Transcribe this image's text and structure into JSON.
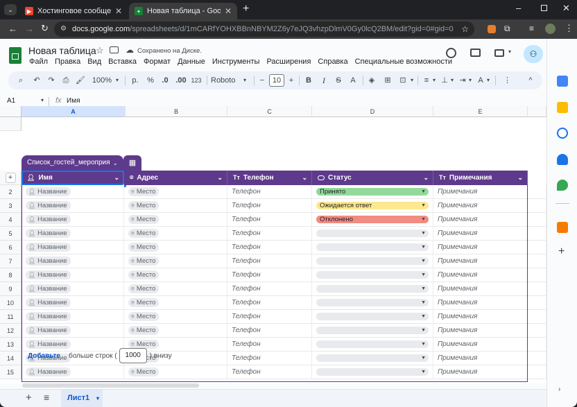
{
  "browser": {
    "tabs": [
      {
        "title": "Хостинговое сообщество «Tim",
        "favicon_color": "#e8462f",
        "active": false
      },
      {
        "title": "Новая таблица - Google Табли",
        "favicon_color": "#188038",
        "active": true
      }
    ],
    "new_tab": "+",
    "url_host": "docs.google.com",
    "url_path": "/spreadsheets/d/1mCARfYOHXBBnNBYM2Z6y7eJQ3vhzpDlmV0Gy0lcQ2BM/edit?gid=0#gid=0"
  },
  "doc": {
    "title": "Новая таблица",
    "saved_status": "Сохранено на Диске.",
    "menu": [
      "Файл",
      "Правка",
      "Вид",
      "Вставка",
      "Формат",
      "Данные",
      "Инструменты",
      "Расширения",
      "Справка",
      "Специальные возможности"
    ]
  },
  "toolbar": {
    "zoom": "100%",
    "currency": "р.",
    "percent": "%",
    "dec_less": ".0",
    "dec_more": ".00",
    "number_format": "123",
    "font": "Roboto",
    "font_size": "10",
    "bold": "B",
    "italic": "I",
    "text_color": "A"
  },
  "formula": {
    "cell_ref": "A1",
    "fx": "fx",
    "content": "Имя"
  },
  "columns": [
    "A",
    "B",
    "C",
    "D",
    "E"
  ],
  "table": {
    "name": "Список_гостей_мероприя",
    "headers": [
      {
        "label": "Имя",
        "icon": "person-icon"
      },
      {
        "label": "Адрес",
        "icon": "location-icon"
      },
      {
        "label": "Телефон",
        "icon": "text-icon"
      },
      {
        "label": "Статус",
        "icon": "dropdown-chip-icon"
      },
      {
        "label": "Примечания",
        "icon": "text-icon"
      }
    ],
    "placeholder_name": "Название",
    "placeholder_address": "Место",
    "placeholder_phone": "Телефон",
    "placeholder_notes": "Примечания",
    "rows": [
      {
        "num": "2",
        "status": "Принято",
        "status_color": "#93d99b"
      },
      {
        "num": "3",
        "status": "Ожидается ответ",
        "status_color": "#fce88f"
      },
      {
        "num": "4",
        "status": "Отклонено",
        "status_color": "#f28b82"
      },
      {
        "num": "5",
        "status": "",
        "status_color": "#e8eaed"
      },
      {
        "num": "6",
        "status": "",
        "status_color": "#e8eaed"
      },
      {
        "num": "7",
        "status": "",
        "status_color": "#e8eaed"
      },
      {
        "num": "8",
        "status": "",
        "status_color": "#e8eaed"
      },
      {
        "num": "9",
        "status": "",
        "status_color": "#e8eaed"
      },
      {
        "num": "10",
        "status": "",
        "status_color": "#e8eaed"
      },
      {
        "num": "11",
        "status": "",
        "status_color": "#e8eaed"
      },
      {
        "num": "12",
        "status": "",
        "status_color": "#e8eaed"
      },
      {
        "num": "13",
        "status": "",
        "status_color": "#e8eaed"
      },
      {
        "num": "14",
        "status": "",
        "status_color": "#e8eaed"
      },
      {
        "num": "15",
        "status": "",
        "status_color": "#e8eaed"
      }
    ]
  },
  "add_rows": {
    "button": "Добавьте",
    "text_before": "больше строк (",
    "count": "1000",
    "text_after": ") внизу"
  },
  "sheets": {
    "add": "+",
    "list": "≡",
    "active": "Лист1"
  },
  "colors": {
    "accent": "#5e3a8c",
    "sheets_green": "#188038"
  }
}
